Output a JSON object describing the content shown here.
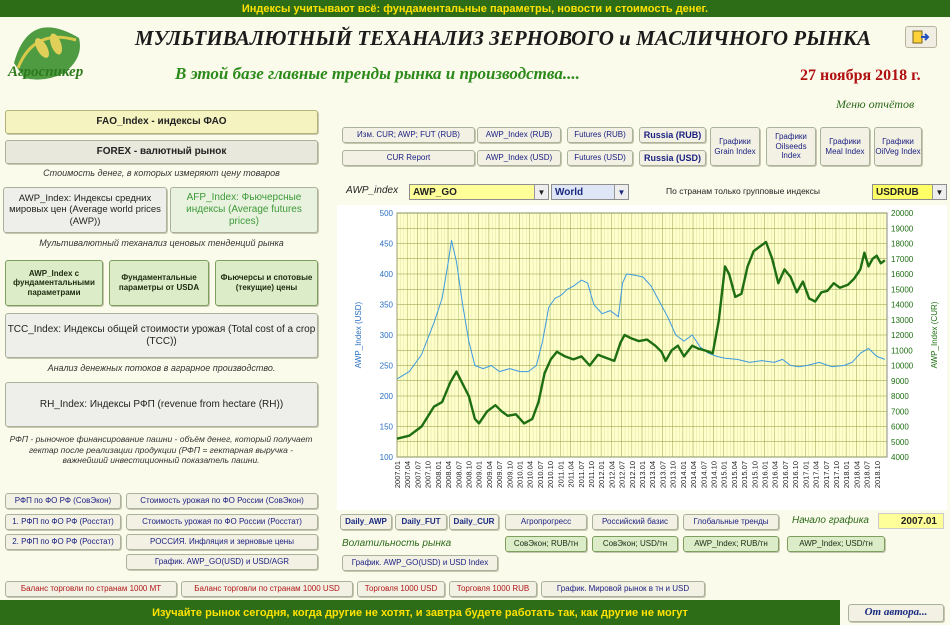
{
  "top_banner": "Индексы учитывают всё: фундаментальные параметры, новости и стоимость денег.",
  "bottom_banner": "Изучайте рынок сегодня, когда другие не хотят, и завтра будете работать так, как другие не могут",
  "logo_text": "Агроспикер",
  "title": "МУЛЬТИВАЛЮТНЫЙ  ТЕХАНАЛИЗ ЗЕРНОВОГО и МАСЛИЧНОГО  РЫНКА",
  "subtitle": "В этой базе главные тренды рынка и  производства....",
  "date": "27 ноября 2018 г.",
  "menu_label": "Меню отчётов",
  "left": {
    "fao": "FAO_Index - индексы ФАО",
    "forex": "FOREX - валютный рынок",
    "note1": "Стоимость денег, в которых измеряют цену товаров",
    "awp": "AWP_Index: Индексы средних мировых цен (Average world prices (AWP))",
    "afp": "AFP_Index: Фьючерсные индексы (Average futures prices)",
    "note2": "Мультивалютный теханализ ценовых тенденций рынка",
    "g1": "AWP_Index с фундаментальными параметрами",
    "g2": "Фундаментальные параметры от USDA",
    "g3": "Фьючерсы и спотовые (текущие) цены",
    "tcc": "TCC_Index: Индексы общей стоимости урожая (Total cost of a crop (TCC))",
    "note3": "Анализ денежных потоков в аграрное производство.",
    "rh": "RH_Index: Индексы РФП (revenue from hectare (RH))",
    "note4": "РФП - рыночное финансирование пашни - объём денег, который получает гектар после реализации продукции (РФП = гектарная выручка - важнейший инвестиционный показатель пашни.",
    "r1a": "РФП по ФО РФ (СовЭкон)",
    "r1b": "Стоимость урожая по ФО России (СовЭкон)",
    "r2a": "1. РФП по ФО РФ (Росстат)",
    "r2b": "Стоимость урожая по ФО России (Росстат)",
    "r3a": "2. РФП по ФО РФ (Росстат)",
    "r3b": "РОССИЯ. Инфляция и зерновые цены",
    "r4": "График. AWP_GO(USD) и USD/AGR"
  },
  "top_buttons": {
    "izm": "Изм. CUR; AWP; FUT (RUB)",
    "awp_rub": "AWP_Index (RUB)",
    "fut_rub": "Futures (RUB)",
    "russia_rub": "Russia (RUB)",
    "cur_report": "CUR Report",
    "awp_usd": "AWP_Index (USD)",
    "fut_usd": "Futures (USD)",
    "russia_usd": "Russia (USD)",
    "grain": "Графики Grain Index",
    "oilseeds": "Графики Oilseeds Index",
    "meal": "Графики Meal Index",
    "oilveg": "Графики OilVeg Index"
  },
  "selectors": {
    "awp_label": "AWP_index",
    "awp_value": "AWP_GO",
    "region_value": "World",
    "note": "По странам только групповые индексы",
    "cur_value": "USDRUB"
  },
  "bottom_buttons": {
    "daily_awp": "Daily_AWP",
    "daily_fut": "Daily_FUT",
    "daily_cur": "Daily_CUR",
    "agro": "Агропрогресс",
    "ru_basis": "Российский базис",
    "global": "Глобальные тренды",
    "start_label": "Начало графика",
    "start_value": "2007.01",
    "vol_label": "Волатильность рынка",
    "sov_rub": "СовЭкон; RUB/тн",
    "sov_usd": "СовЭкон; USD/тн",
    "awp_rubt": "AWP_Index; RUB/тн",
    "awp_usdt": "AWP_Index;  USD/тн",
    "graph_awp": "График. AWP_GO(USD) и USD Index"
  },
  "footer_buttons": {
    "f1": "Баланс торговли по странам 1000 MT",
    "f2": "Баланс торговли по странам 1000 USD",
    "f3": "Торговля 1000 USD",
    "f4": "Торговля 1000 RUB",
    "f5": "График. Мировой рынок в тн и USD"
  },
  "author_button": "От автора...",
  "colors": {
    "banner": "#2e6d18",
    "banner_text": "#ffe200",
    "awp_line": "#3d9ae0",
    "cur_line": "#1e6e12",
    "plot_bg": "#ffffcc"
  },
  "chart_data": {
    "type": "line",
    "ylabel": "AWP_Index (USD)",
    "y2label": "AWP_Index (CUR)",
    "ylim": [
      100,
      500
    ],
    "y2lim": [
      4000,
      20000
    ],
    "yticks": [
      100,
      150,
      200,
      250,
      300,
      350,
      400,
      450,
      500
    ],
    "y2ticks": [
      4000,
      5000,
      6000,
      7000,
      8000,
      9000,
      10000,
      11000,
      12000,
      13000,
      14000,
      15000,
      16000,
      17000,
      18000,
      19000,
      20000
    ],
    "xticks": [
      "2007.01",
      "2007.04",
      "2007.07",
      "2007.10",
      "2008.01",
      "2008.04",
      "2008.07",
      "2008.10",
      "2009.01",
      "2009.04",
      "2009.07",
      "2009.10",
      "2010.01",
      "2010.04",
      "2010.07",
      "2010.10",
      "2011.01",
      "2011.04",
      "2011.07",
      "2011.10",
      "2012.01",
      "2012.04",
      "2012.07",
      "2012.10",
      "2013.01",
      "2013.04",
      "2013.07",
      "2013.10",
      "2014.01",
      "2014.04",
      "2014.07",
      "2014.10",
      "2015.01",
      "2015.04",
      "2015.07",
      "2015.10",
      "2016.01",
      "2016.04",
      "2016.07",
      "2016.10",
      "2017.01",
      "2017.04",
      "2017.07",
      "2017.10",
      "2018.01",
      "2018.04",
      "2018.07",
      "2018.10"
    ],
    "series": [
      {
        "name": "AWP_Index (USD)",
        "axis": "left",
        "values": [
          [
            2007.0,
            228
          ],
          [
            2007.3,
            240
          ],
          [
            2007.6,
            268
          ],
          [
            2007.9,
            320
          ],
          [
            2008.1,
            360
          ],
          [
            2008.25,
            420
          ],
          [
            2008.33,
            455
          ],
          [
            2008.45,
            420
          ],
          [
            2008.6,
            350
          ],
          [
            2008.75,
            290
          ],
          [
            2008.9,
            250
          ],
          [
            2009.1,
            245
          ],
          [
            2009.3,
            250
          ],
          [
            2009.5,
            240
          ],
          [
            2009.75,
            245
          ],
          [
            2010.0,
            240
          ],
          [
            2010.2,
            240
          ],
          [
            2010.4,
            250
          ],
          [
            2010.55,
            290
          ],
          [
            2010.7,
            345
          ],
          [
            2010.85,
            360
          ],
          [
            2011.0,
            365
          ],
          [
            2011.15,
            375
          ],
          [
            2011.3,
            380
          ],
          [
            2011.5,
            390
          ],
          [
            2011.65,
            385
          ],
          [
            2011.8,
            350
          ],
          [
            2012.0,
            335
          ],
          [
            2012.2,
            340
          ],
          [
            2012.4,
            330
          ],
          [
            2012.5,
            385
          ],
          [
            2012.6,
            400
          ],
          [
            2012.8,
            398
          ],
          [
            2013.0,
            395
          ],
          [
            2013.2,
            380
          ],
          [
            2013.4,
            355
          ],
          [
            2013.6,
            330
          ],
          [
            2013.8,
            300
          ],
          [
            2014.0,
            290
          ],
          [
            2014.2,
            300
          ],
          [
            2014.4,
            280
          ],
          [
            2014.6,
            270
          ],
          [
            2014.8,
            265
          ],
          [
            2015.0,
            262
          ],
          [
            2015.3,
            260
          ],
          [
            2015.6,
            255
          ],
          [
            2015.9,
            258
          ],
          [
            2016.2,
            255
          ],
          [
            2016.4,
            260
          ],
          [
            2016.6,
            250
          ],
          [
            2016.8,
            248
          ],
          [
            2017.0,
            250
          ],
          [
            2017.3,
            255
          ],
          [
            2017.6,
            248
          ],
          [
            2017.9,
            250
          ],
          [
            2018.1,
            255
          ],
          [
            2018.3,
            270
          ],
          [
            2018.5,
            278
          ],
          [
            2018.7,
            265
          ],
          [
            2018.9,
            260
          ]
        ]
      },
      {
        "name": "AWP_Index (CUR)",
        "axis": "right",
        "values": [
          [
            2007.0,
            5200
          ],
          [
            2007.3,
            5400
          ],
          [
            2007.6,
            6000
          ],
          [
            2007.9,
            7300
          ],
          [
            2008.1,
            7600
          ],
          [
            2008.3,
            8900
          ],
          [
            2008.45,
            9600
          ],
          [
            2008.6,
            8800
          ],
          [
            2008.75,
            8000
          ],
          [
            2008.9,
            6500
          ],
          [
            2009.0,
            6200
          ],
          [
            2009.2,
            7000
          ],
          [
            2009.4,
            7400
          ],
          [
            2009.55,
            7000
          ],
          [
            2009.7,
            6700
          ],
          [
            2009.9,
            6800
          ],
          [
            2010.1,
            6200
          ],
          [
            2010.3,
            6500
          ],
          [
            2010.45,
            7600
          ],
          [
            2010.6,
            9500
          ],
          [
            2010.75,
            10400
          ],
          [
            2010.9,
            10900
          ],
          [
            2011.1,
            10600
          ],
          [
            2011.3,
            10400
          ],
          [
            2011.5,
            10600
          ],
          [
            2011.7,
            10000
          ],
          [
            2011.9,
            10700
          ],
          [
            2012.1,
            10500
          ],
          [
            2012.3,
            10300
          ],
          [
            2012.45,
            11500
          ],
          [
            2012.55,
            12000
          ],
          [
            2012.7,
            11800
          ],
          [
            2012.9,
            11600
          ],
          [
            2013.1,
            11700
          ],
          [
            2013.3,
            11300
          ],
          [
            2013.45,
            10900
          ],
          [
            2013.55,
            10300
          ],
          [
            2013.7,
            11000
          ],
          [
            2013.85,
            11300
          ],
          [
            2014.0,
            10600
          ],
          [
            2014.2,
            11300
          ],
          [
            2014.35,
            11100
          ],
          [
            2014.5,
            11000
          ],
          [
            2014.7,
            10800
          ],
          [
            2014.85,
            13000
          ],
          [
            2015.0,
            16500
          ],
          [
            2015.1,
            16000
          ],
          [
            2015.25,
            14500
          ],
          [
            2015.4,
            14700
          ],
          [
            2015.55,
            16500
          ],
          [
            2015.7,
            17500
          ],
          [
            2015.85,
            17800
          ],
          [
            2016.0,
            18100
          ],
          [
            2016.15,
            17000
          ],
          [
            2016.3,
            15400
          ],
          [
            2016.45,
            16300
          ],
          [
            2016.6,
            15800
          ],
          [
            2016.75,
            14800
          ],
          [
            2016.9,
            15500
          ],
          [
            2017.05,
            14400
          ],
          [
            2017.2,
            14200
          ],
          [
            2017.35,
            14800
          ],
          [
            2017.5,
            14900
          ],
          [
            2017.65,
            15400
          ],
          [
            2017.8,
            15100
          ],
          [
            2018.0,
            15300
          ],
          [
            2018.15,
            15700
          ],
          [
            2018.3,
            16300
          ],
          [
            2018.4,
            17400
          ],
          [
            2018.5,
            16500
          ],
          [
            2018.6,
            17000
          ],
          [
            2018.7,
            17200
          ],
          [
            2018.8,
            16700
          ],
          [
            2018.9,
            16900
          ]
        ]
      }
    ]
  }
}
